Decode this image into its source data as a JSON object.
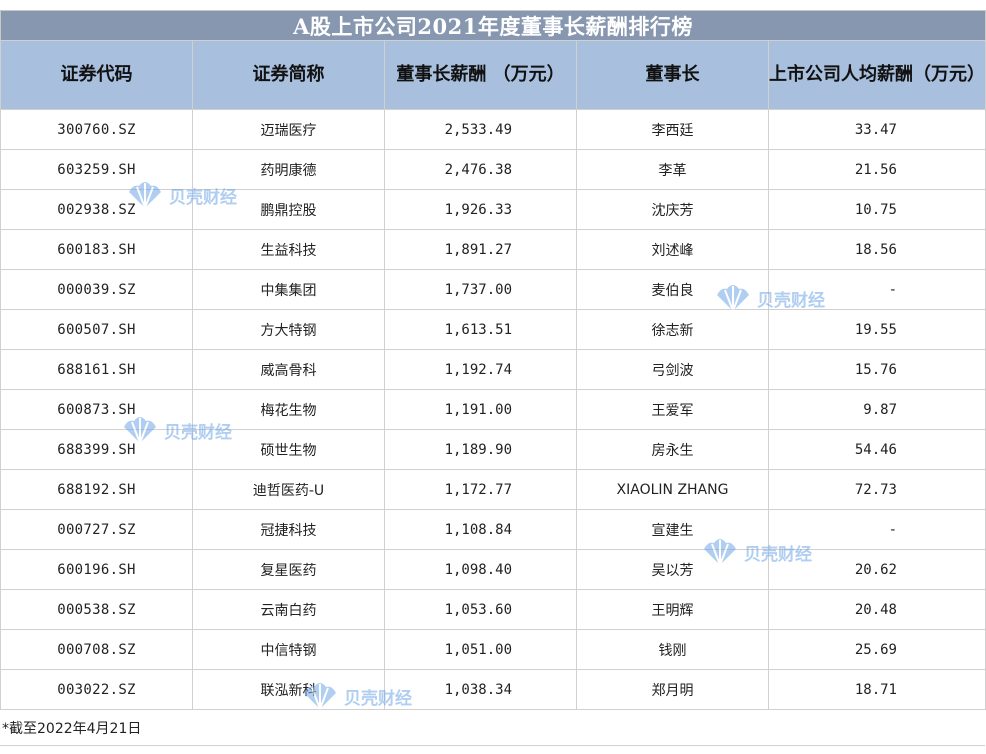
{
  "title": "A股上市公司2021年度董事长薪酬排行榜",
  "columns": [
    "证券代码",
    "证券简称",
    "董事长薪酬  （万元）",
    "董事长",
    "上市公司人均薪酬（万元）"
  ],
  "rows": [
    {
      "code": "300760.SZ",
      "name": "迈瑞医疗",
      "pay": "2,533.49",
      "chairman": "李西廷",
      "avg": "33.47"
    },
    {
      "code": "603259.SH",
      "name": "药明康德",
      "pay": "2,476.38",
      "chairman": "李革",
      "avg": "21.56"
    },
    {
      "code": "002938.SZ",
      "name": "鹏鼎控股",
      "pay": "1,926.33",
      "chairman": "沈庆芳",
      "avg": "10.75"
    },
    {
      "code": "600183.SH",
      "name": "生益科技",
      "pay": "1,891.27",
      "chairman": "刘述峰",
      "avg": "18.56"
    },
    {
      "code": "000039.SZ",
      "name": "中集集团",
      "pay": "1,737.00",
      "chairman": "麦伯良",
      "avg": "-"
    },
    {
      "code": "600507.SH",
      "name": "方大特钢",
      "pay": "1,613.51",
      "chairman": "徐志新",
      "avg": "19.55"
    },
    {
      "code": "688161.SH",
      "name": "威高骨科",
      "pay": "1,192.74",
      "chairman": "弓剑波",
      "avg": "15.76"
    },
    {
      "code": "600873.SH",
      "name": "梅花生物",
      "pay": "1,191.00",
      "chairman": "王爱军",
      "avg": "9.87"
    },
    {
      "code": "688399.SH",
      "name": "硕世生物",
      "pay": "1,189.90",
      "chairman": "房永生",
      "avg": "54.46"
    },
    {
      "code": "688192.SH",
      "name": "迪哲医药-U",
      "pay": "1,172.77",
      "chairman": "XIAOLIN ZHANG",
      "avg": "72.73"
    },
    {
      "code": "000727.SZ",
      "name": "冠捷科技",
      "pay": "1,108.84",
      "chairman": "宣建生",
      "avg": "-"
    },
    {
      "code": "600196.SH",
      "name": "复星医药",
      "pay": "1,098.40",
      "chairman": "吴以芳",
      "avg": "20.62"
    },
    {
      "code": "000538.SZ",
      "name": "云南白药",
      "pay": "1,053.60",
      "chairman": "王明辉",
      "avg": "20.48"
    },
    {
      "code": "000708.SZ",
      "name": "中信特钢",
      "pay": "1,051.00",
      "chairman": "钱刚",
      "avg": "25.69"
    },
    {
      "code": "003022.SZ",
      "name": "联泓新科",
      "pay": "1,038.34",
      "chairman": "郑月明",
      "avg": "18.71"
    }
  ],
  "note": "*截至2022年4月21日",
  "watermark": {
    "text": "贝壳财经",
    "icon": "shell-logo-icon",
    "color": "#6fa7e6"
  },
  "colors": {
    "title_bg": "#8797b0",
    "header_bg": "#a9bfde"
  }
}
